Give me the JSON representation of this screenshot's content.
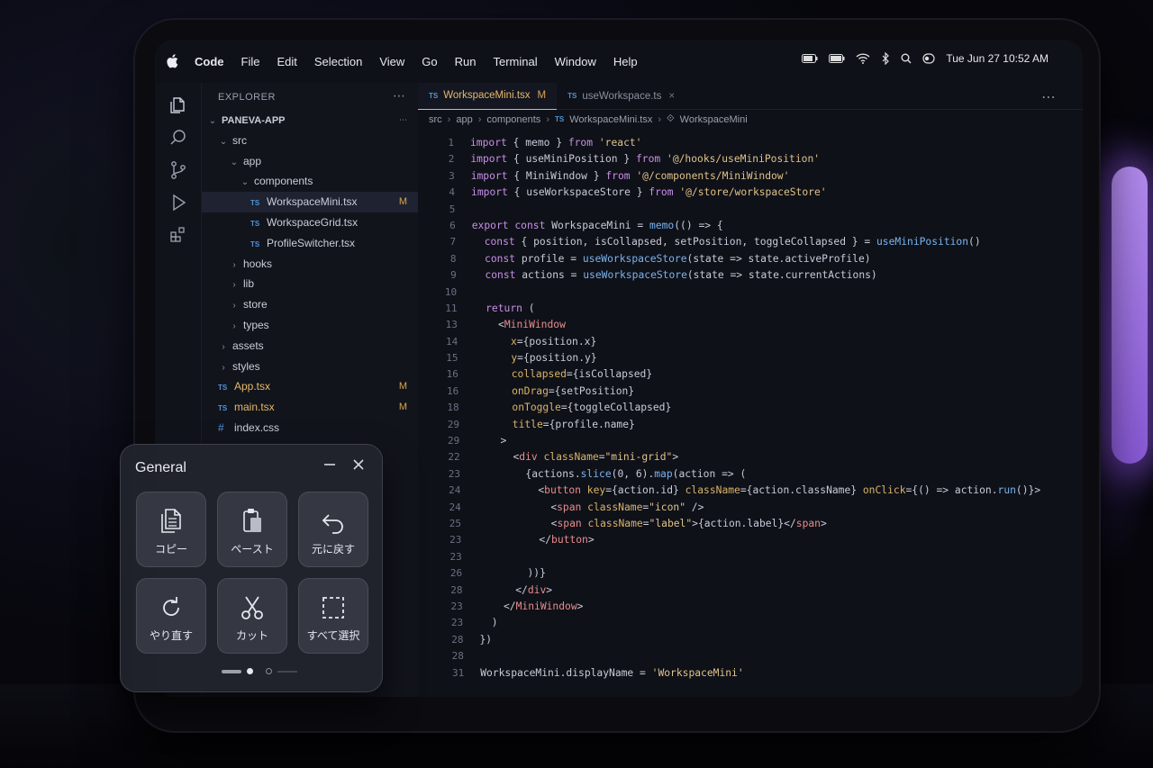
{
  "menubar": {
    "app": "Code",
    "items": [
      "File",
      "Edit",
      "Selection",
      "View",
      "Go",
      "Run",
      "Terminal",
      "Window",
      "Help"
    ],
    "clock": "Tue Jun 27  10:52 AM"
  },
  "explorer": {
    "header": "EXPLORER",
    "project": "PANEVA-APP",
    "tree": [
      {
        "name": "src",
        "kind": "folder",
        "open": true,
        "depth": 1
      },
      {
        "name": "app",
        "kind": "folder",
        "open": true,
        "depth": 2
      },
      {
        "name": "components",
        "kind": "folder",
        "open": true,
        "depth": 3
      },
      {
        "name": "WorkspaceMini.tsx",
        "kind": "ts",
        "depth": 4,
        "status": "M",
        "selected": true
      },
      {
        "name": "WorkspaceGrid.tsx",
        "kind": "ts",
        "depth": 4
      },
      {
        "name": "ProfileSwitcher.tsx",
        "kind": "ts",
        "depth": 4
      },
      {
        "name": "hooks",
        "kind": "folder",
        "open": false,
        "depth": 2
      },
      {
        "name": "lib",
        "kind": "folder",
        "open": false,
        "depth": 2
      },
      {
        "name": "store",
        "kind": "folder",
        "open": false,
        "depth": 2
      },
      {
        "name": "types",
        "kind": "folder",
        "open": false,
        "depth": 2
      },
      {
        "name": "assets",
        "kind": "folder",
        "open": false,
        "depth": 1
      },
      {
        "name": "styles",
        "kind": "folder",
        "open": false,
        "depth": 1
      },
      {
        "name": "App.tsx",
        "kind": "ts",
        "depth": 1,
        "status": "M"
      },
      {
        "name": "main.tsx",
        "kind": "ts",
        "depth": 1,
        "status": "M"
      },
      {
        "name": "index.css",
        "kind": "css",
        "depth": 1
      }
    ]
  },
  "editor": {
    "tabs": [
      {
        "label": "WorkspaceMini.tsx",
        "status": "M",
        "active": true
      },
      {
        "label": "useWorkspace.ts",
        "close": "×",
        "active": false
      }
    ],
    "breadcrumb": [
      "src",
      "app",
      "components",
      "WorkspaceMini.tsx",
      "WorkspaceMini"
    ],
    "lines": [
      {
        "n": "1",
        "t": "import { memo } from 'react'"
      },
      {
        "n": "2",
        "t": "import { useMiniPosition } from '@/hooks/useMiniPosition'"
      },
      {
        "n": "3",
        "t": "import { MiniWindow } from '@/components/MiniWindow'"
      },
      {
        "n": "4",
        "t": "import { useWorkspaceStore } from '@/store/workspaceStore'"
      },
      {
        "n": "5",
        "t": ""
      },
      {
        "n": "6",
        "t": "export const WorkspaceMini = memo(() => {"
      },
      {
        "n": "7",
        "t": "  const { position, isCollapsed, setPosition, toggleCollapsed } = useMiniPosition()"
      },
      {
        "n": "8",
        "t": "  const profile = useWorkspaceStore(state => state.activeProfile)"
      },
      {
        "n": "9",
        "t": "  const actions = useWorkspaceStore(state => state.currentActions)"
      },
      {
        "n": "10",
        "t": ""
      },
      {
        "n": "11",
        "t": "  return ("
      },
      {
        "n": "13",
        "t": "    <MiniWindow"
      },
      {
        "n": "14",
        "t": "      x={position.x}"
      },
      {
        "n": "15",
        "t": "      y={position.y}"
      },
      {
        "n": "16",
        "t": "      collapsed={isCollapsed}"
      },
      {
        "n": "16",
        "t": "      onDrag={setPosition}"
      },
      {
        "n": "18",
        "t": "      onToggle={toggleCollapsed}"
      },
      {
        "n": "29",
        "t": "      title={profile.name}"
      },
      {
        "n": "29",
        "t": "    >"
      },
      {
        "n": "22",
        "t": "      <div className=\"mini-grid\">"
      },
      {
        "n": "23",
        "t": "        {actions.slice(0, 6).map(action => ("
      },
      {
        "n": "24",
        "t": "          <button key={action.id} className={action.className} onClick={() => action.run()}>"
      },
      {
        "n": "24",
        "t": "            <span className=\"icon\" />"
      },
      {
        "n": "25",
        "t": "            <span className=\"label\">{action.label}</span>"
      },
      {
        "n": "23",
        "t": "          </button>"
      },
      {
        "n": "23",
        "t": ""
      },
      {
        "n": "26",
        "t": "        ))}"
      },
      {
        "n": "28",
        "t": "      </div>"
      },
      {
        "n": "23",
        "t": "    </MiniWindow>"
      },
      {
        "n": "23",
        "t": "  )"
      },
      {
        "n": "28",
        "t": "})"
      },
      {
        "n": "28",
        "t": ""
      },
      {
        "n": "31",
        "t": "WorkspaceMini.displayName = 'WorkspaceMini'"
      }
    ]
  },
  "panel": {
    "title": "General",
    "buttons": [
      {
        "label": "コピー",
        "icon": "copy-icon"
      },
      {
        "label": "ペースト",
        "icon": "paste-icon"
      },
      {
        "label": "元に戻す",
        "icon": "undo-icon"
      },
      {
        "label": "やり直す",
        "icon": "redo-icon"
      },
      {
        "label": "カット",
        "icon": "scissors-icon"
      },
      {
        "label": "すべて選択",
        "icon": "select-all-icon"
      }
    ]
  },
  "colors": {
    "accent": "#e6b868",
    "ts": "#4f94d4",
    "glow": "#a070e8"
  }
}
